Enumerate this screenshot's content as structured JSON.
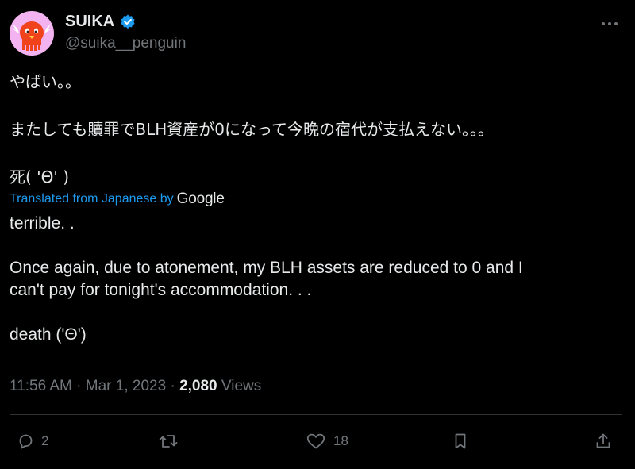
{
  "author": {
    "display_name": "SUIKA",
    "handle": "@suika__penguin",
    "verified": true,
    "avatar_icon": "red-penguin-mascot-icon"
  },
  "tweet": {
    "original_lines": [
      "やばい。。",
      "",
      "またしても贖罪でBLH資産が0になって今晩の宿代が支払えない。。。",
      "",
      "死( 'Θ' )"
    ],
    "translation_notice": "Translated from Japanese by",
    "translation_provider": "Google",
    "translated_lines": [
      "terrible. .",
      "",
      "Once again, due to atonement, my BLH assets are reduced to 0 and I",
      "can't pay for tonight's accommodation. . .",
      "",
      "death ('Θ')"
    ]
  },
  "meta": {
    "time": "11:56 AM",
    "separator": " · ",
    "date": "Mar 1, 2023",
    "views_count": "2,080",
    "views_label": "Views"
  },
  "actions": {
    "reply_count": "2",
    "repost_count": "",
    "like_count": "18"
  },
  "colors": {
    "background": "#000000",
    "text": "#e7e9ea",
    "muted": "#71767b",
    "link": "#1d9bf0",
    "verified_badge": "#1d9bf0",
    "avatar_bg": "#f3b3f0",
    "mascot": "#f0431c",
    "divider": "#2f3336"
  }
}
